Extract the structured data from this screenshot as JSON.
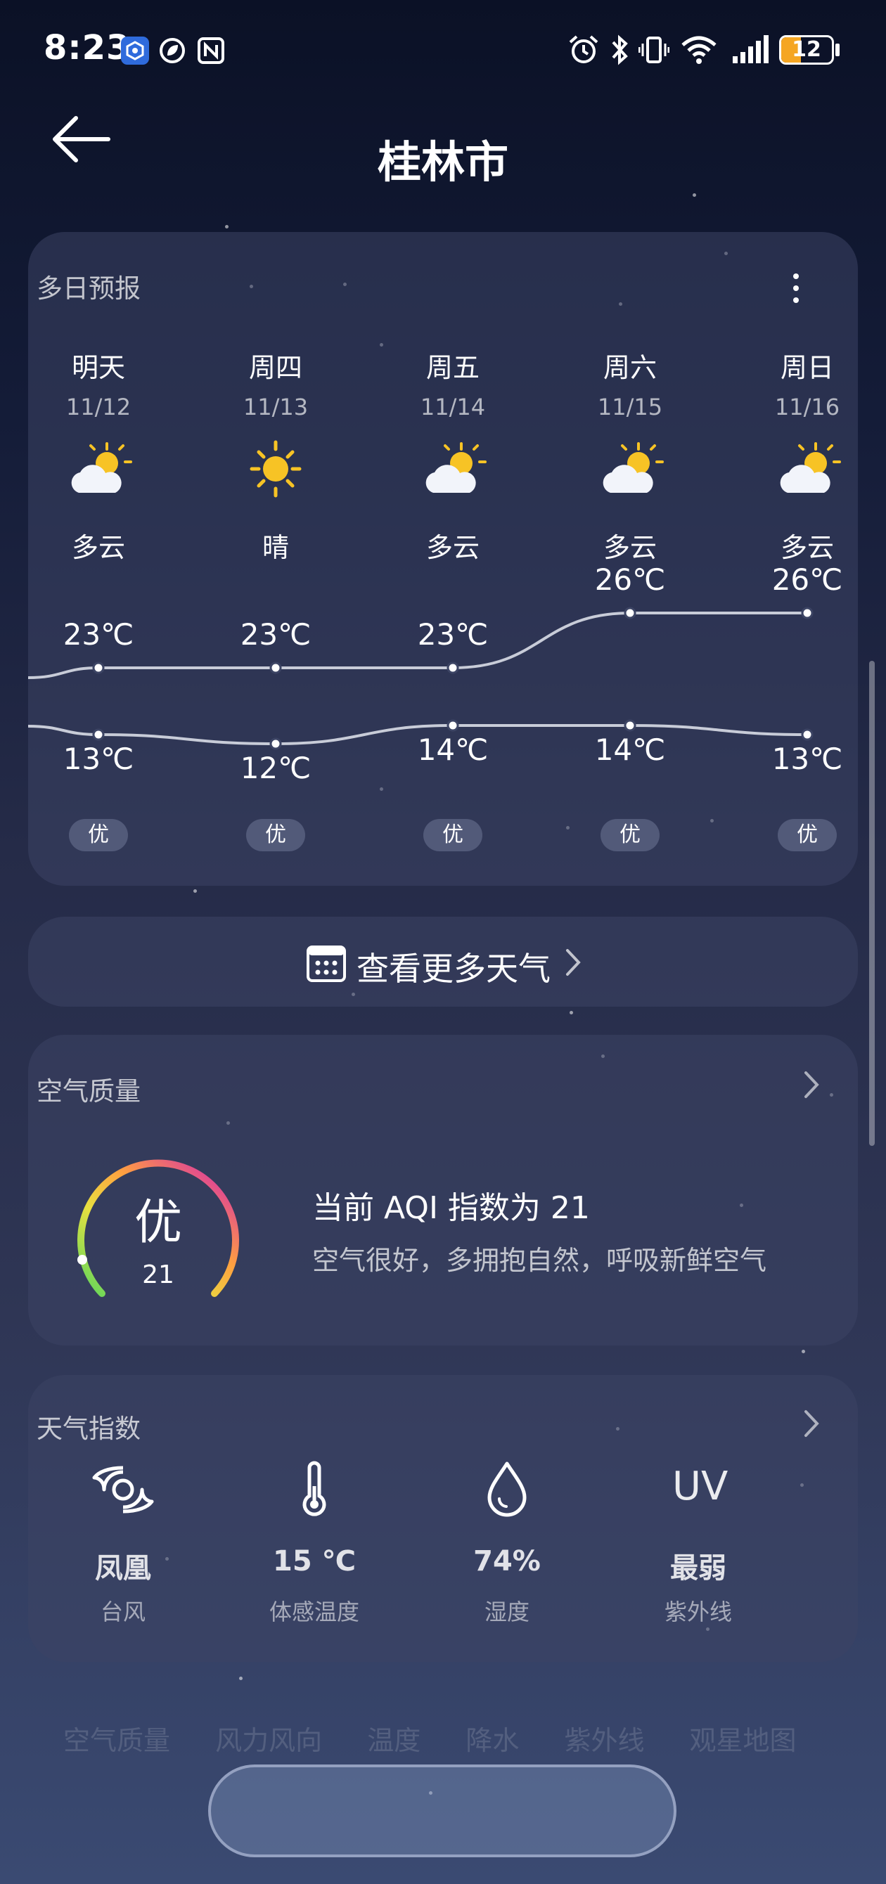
{
  "status_bar": {
    "time": "8:23",
    "battery": "12",
    "battery_fraction": 0.12,
    "icons": [
      "app-badge-icon",
      "leaf-circle-icon",
      "nfc-icon",
      "alarm-icon",
      "bluetooth-icon",
      "vibrate-icon",
      "wifi-icon",
      "signal-icon",
      "battery-icon"
    ]
  },
  "header": {
    "title": "桂林市"
  },
  "forecast": {
    "title": "多日预报",
    "days": [
      {
        "name": "明天",
        "date": "11/12",
        "icon": "partly-cloudy-icon",
        "condition": "多云",
        "high": "23℃",
        "low": "13℃",
        "high_value": 23,
        "low_value": 13,
        "aqi": "优"
      },
      {
        "name": "周四",
        "date": "11/13",
        "icon": "sunny-icon",
        "condition": "晴",
        "high": "23℃",
        "low": "12℃",
        "high_value": 23,
        "low_value": 12,
        "aqi": "优"
      },
      {
        "name": "周五",
        "date": "11/14",
        "icon": "partly-cloudy-icon",
        "condition": "多云",
        "high": "23℃",
        "low": "14℃",
        "high_value": 23,
        "low_value": 14,
        "aqi": "优"
      },
      {
        "name": "周六",
        "date": "11/15",
        "icon": "partly-cloudy-icon",
        "condition": "多云",
        "high": "26℃",
        "low": "14℃",
        "high_value": 26,
        "low_value": 14,
        "aqi": "优"
      },
      {
        "name": "周日",
        "date": "11/16",
        "icon": "partly-cloudy-icon",
        "condition": "多云",
        "high": "26℃",
        "low": "13℃",
        "high_value": 26,
        "low_value": 13,
        "aqi": "优"
      }
    ]
  },
  "more_weather": {
    "label": "查看更多天气"
  },
  "air_quality": {
    "title": "空气质量",
    "level": "优",
    "aqi": "21",
    "headline": "当前 AQI 指数为 21",
    "description": "空气很好，多拥抱自然，呼吸新鲜空气"
  },
  "weather_index": {
    "title": "天气指数",
    "items": [
      {
        "icon": "typhoon-icon",
        "value": "凤凰",
        "label": "台风"
      },
      {
        "icon": "thermometer-icon",
        "value": "15 ℃",
        "label": "体感温度"
      },
      {
        "icon": "water-drop-icon",
        "value": "74%",
        "label": "湿度"
      },
      {
        "icon": "uv-icon",
        "icon_text": "UV",
        "value": "最弱",
        "label": "紫外线"
      }
    ]
  },
  "bottom_tabs": [
    "空气质量",
    "风力风向",
    "温度",
    "降水",
    "紫外线",
    "观星地图"
  ],
  "colors": {
    "accent_sun": "#f7c325",
    "cloud": "#f2f4fa",
    "battery": "#f5a623",
    "line": "#c8ccd8",
    "gauge_start": "#5cd65c",
    "gauge_mid": "#ffa040",
    "gauge_end": "#d21fb8"
  }
}
